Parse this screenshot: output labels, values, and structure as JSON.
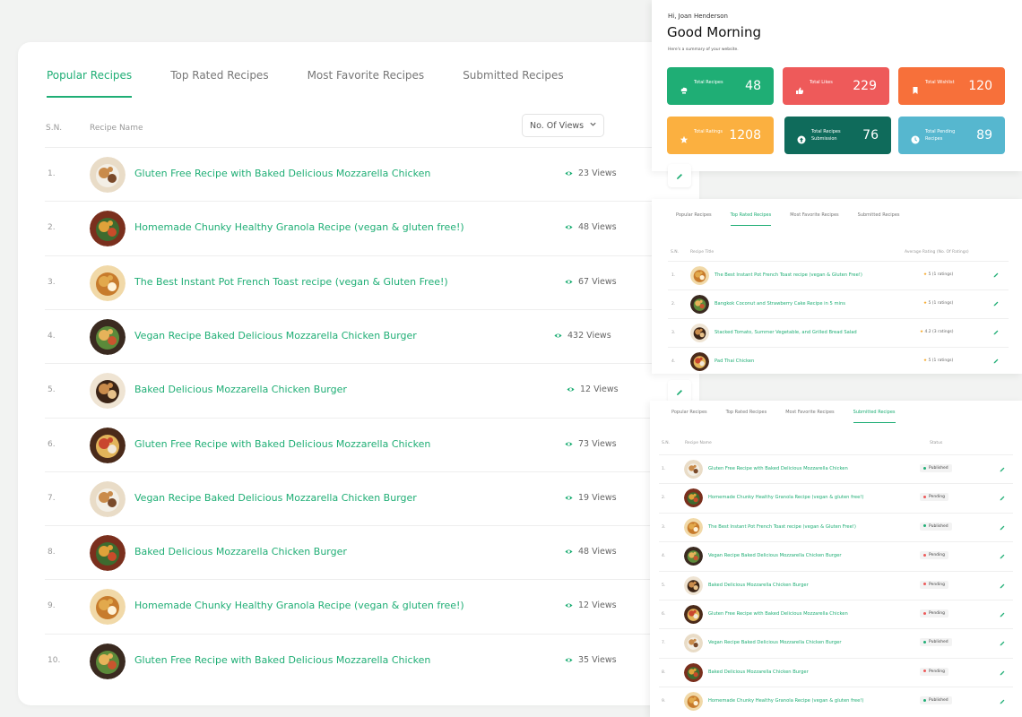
{
  "main": {
    "tabs": [
      "Popular Recipes",
      "Top Rated Recipes",
      "Most Favorite Recipes",
      "Submitted Recipes"
    ],
    "active_tab": 0,
    "col_sn": "S.N.",
    "col_name": "Recipe Name",
    "sort_label": "No. Of Views",
    "rows": [
      {
        "sn": "1.",
        "name": "Gluten Free Recipe with Baked Delicious Mozzarella Chicken",
        "views": "23 Views"
      },
      {
        "sn": "2.",
        "name": "Homemade Chunky Healthy Granola Recipe (vegan & gluten free!)",
        "views": "48 Views"
      },
      {
        "sn": "3.",
        "name": "The Best Instant Pot French Toast recipe (vegan & Gluten Free!)",
        "views": "67 Views"
      },
      {
        "sn": "4.",
        "name": "Vegan Recipe Baked Delicious Mozzarella Chicken Burger",
        "views": "432 Views"
      },
      {
        "sn": "5.",
        "name": "Baked Delicious Mozzarella Chicken Burger",
        "views": "12 Views"
      },
      {
        "sn": "6.",
        "name": "Gluten Free Recipe with Baked Delicious Mozzarella Chicken",
        "views": "73 Views"
      },
      {
        "sn": "7.",
        "name": "Vegan Recipe Baked Delicious Mozzarella Chicken Burger",
        "views": "19 Views"
      },
      {
        "sn": "8.",
        "name": "Baked Delicious Mozzarella Chicken Burger",
        "views": "48 Views"
      },
      {
        "sn": "9.",
        "name": "Homemade Chunky Healthy Granola Recipe (vegan & gluten free!)",
        "views": "12 Views"
      },
      {
        "sn": "10.",
        "name": "Gluten Free Recipe with Baked Delicious Mozzarella Chicken",
        "views": "35 Views"
      }
    ]
  },
  "dashboard": {
    "greeting_small": "Hi, Joan Henderson",
    "greeting": "Good Morning",
    "subtitle": "Here's a summary of your website.",
    "stats": [
      {
        "label": "Total Recipes",
        "value": "48",
        "color": "#1fae75",
        "icon": "chef-hat-icon"
      },
      {
        "label": "Total Likes",
        "value": "229",
        "color": "#ee5a5a",
        "icon": "thumbs-up-icon"
      },
      {
        "label": "Total Wishlist",
        "value": "120",
        "color": "#f7703a",
        "icon": "bookmark-icon"
      },
      {
        "label": "Total Ratings",
        "value": "1208",
        "color": "#fbb040",
        "icon": "star-icon"
      },
      {
        "label": "Total Recipes Submission",
        "value": "76",
        "color": "#0f6b5b",
        "icon": "upload-icon"
      },
      {
        "label": "Total Pending Recipes",
        "value": "89",
        "color": "#56b7cf",
        "icon": "clock-icon"
      }
    ]
  },
  "top_rated": {
    "tabs": [
      "Popular Recipes",
      "Top Rated Recipes",
      "Most Favorite Recipes",
      "Submitted Recipes"
    ],
    "active_tab": 1,
    "col_sn": "S.N.",
    "col_title": "Recipe Title",
    "col_rating": "Average Rating (No. Of Ratings)",
    "rows": [
      {
        "sn": "1.",
        "name": "The Best Instant Pot French Toast recipe (vegan & Gluten Free!)",
        "rating": "5 (1 ratings)"
      },
      {
        "sn": "2.",
        "name": "Bangkok Coconut and Strawberry Cake Recipe in 5 mins",
        "rating": "5 (1 ratings)"
      },
      {
        "sn": "3.",
        "name": "Stacked Tomato, Summer Vegetable, and Grilled Bread Salad",
        "rating": "4.2 (3 ratings)"
      },
      {
        "sn": "4.",
        "name": "Pad Thai Chicken",
        "rating": "5 (1 ratings)"
      }
    ]
  },
  "submitted": {
    "tabs": [
      "Popular Recipes",
      "Top Rated Recipes",
      "Most Favorite Recipes",
      "Submitted Recipes"
    ],
    "active_tab": 3,
    "col_sn": "S.N.",
    "col_name": "Recipe Name",
    "col_status": "Status",
    "rows": [
      {
        "sn": "1.",
        "name": "Gluten Free Recipe with Baked Delicious Mozzarella Chicken",
        "status": "Published"
      },
      {
        "sn": "2.",
        "name": "Homemade Chunky Healthy Granola Recipe (vegan & gluten free!)",
        "status": "Pending"
      },
      {
        "sn": "3.",
        "name": "The Best Instant Pot French Toast recipe (vegan & Gluten Free!)",
        "status": "Published"
      },
      {
        "sn": "4.",
        "name": "Vegan Recipe Baked Delicious Mozzarella Chicken Burger",
        "status": "Pending"
      },
      {
        "sn": "5.",
        "name": "Baked Delicious Mozzarella Chicken Burger",
        "status": "Pending"
      },
      {
        "sn": "6.",
        "name": "Gluten Free Recipe with Baked Delicious Mozzarella Chicken",
        "status": "Pending"
      },
      {
        "sn": "7.",
        "name": "Vegan Recipe Baked Delicious Mozzarella Chicken Burger",
        "status": "Published"
      },
      {
        "sn": "8.",
        "name": "Baked Delicious Mozzarella Chicken Burger",
        "status": "Pending"
      },
      {
        "sn": "9.",
        "name": "Homemade Chunky Healthy Granola Recipe (vegan & gluten free!)",
        "status": "Published"
      }
    ]
  },
  "colors": {
    "accent": "#1fae75",
    "published": "#1fae75",
    "pending": "#ee5a5a",
    "star": "#f5a623"
  }
}
